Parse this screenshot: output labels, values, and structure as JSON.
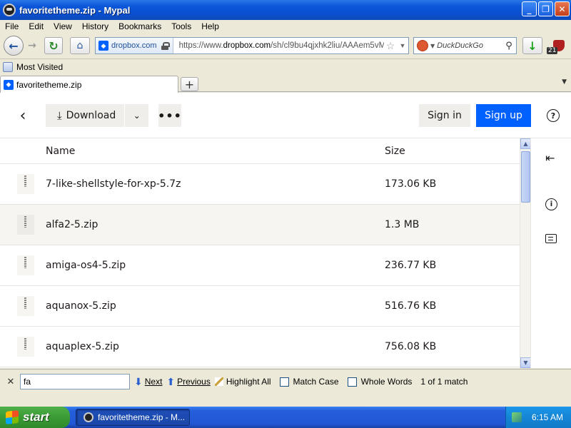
{
  "window": {
    "title": "favoritetheme.zip - Mypal",
    "buttons": {
      "minimize": "_",
      "maximize": "❐",
      "close": "✕"
    }
  },
  "menu": [
    "File",
    "Edit",
    "View",
    "History",
    "Bookmarks",
    "Tools",
    "Help"
  ],
  "navbar": {
    "site_identity": "dropbox.com",
    "url_prefix": "https://www.",
    "url_domain": "dropbox.com",
    "url_rest": "/sh/cl9bu4qjxhk2liu/AAAem5vM",
    "search_placeholder": "DuckDuckGo",
    "ext_badge": "21"
  },
  "bookmarks": {
    "most_visited": "Most Visited"
  },
  "tabs": [
    {
      "label": "favoritetheme.zip"
    }
  ],
  "page": {
    "download_label": "Download",
    "signin_label": "Sign in",
    "signup_label": "Sign up",
    "columns": {
      "name": "Name",
      "size": "Size"
    },
    "files": [
      {
        "name": "7-like-shellstyle-for-xp-5.7z",
        "size": "173.06 KB"
      },
      {
        "name": "alfa2-5.zip",
        "size": "1.3 MB"
      },
      {
        "name": "amiga-os4-5.zip",
        "size": "236.77 KB"
      },
      {
        "name": "aquanox-5.zip",
        "size": "516.76 KB"
      },
      {
        "name": "aquaplex-5.zip",
        "size": "756.08 KB"
      }
    ]
  },
  "findbar": {
    "query": "fa",
    "next_label": "Next",
    "previous_label": "Previous",
    "highlight_label": "Highlight All",
    "match_case_label": "Match Case",
    "whole_words_label": "Whole Words",
    "status": "1 of 1 match"
  },
  "taskbar": {
    "start_label": "start",
    "task_label": "favoritetheme.zip - M...",
    "clock": "6:15 AM"
  },
  "colors": {
    "dropbox_blue": "#0061fe",
    "xp_titlebar": "#0b56d8",
    "xp_start_green": "#3a9a35"
  }
}
